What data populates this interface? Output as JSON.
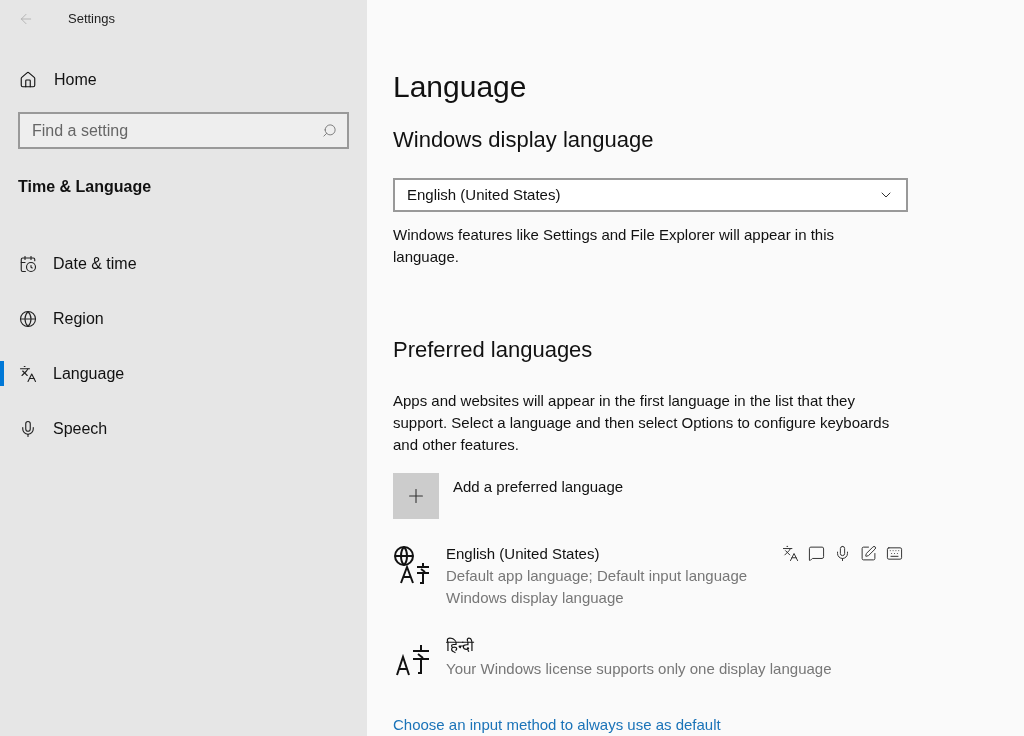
{
  "window": {
    "title": "Settings"
  },
  "sidebar": {
    "home": "Home",
    "search": {
      "placeholder": "Find a setting"
    },
    "section": "Time & Language",
    "items": [
      {
        "label": "Date & time",
        "kind": "datetime",
        "selected": false
      },
      {
        "label": "Region",
        "kind": "region",
        "selected": false
      },
      {
        "label": "Language",
        "kind": "language",
        "selected": true
      },
      {
        "label": "Speech",
        "kind": "speech",
        "selected": false
      }
    ]
  },
  "page": {
    "title": "Language",
    "display_heading": "Windows display language",
    "display_value": "English (United States)",
    "display_note": "Windows features like Settings and File Explorer will appear in this language.",
    "preferred_heading": "Preferred languages",
    "preferred_note": "Apps and websites will appear in the first language in the list that they support. Select a language and then select Options to configure keyboards and other features.",
    "add_label": "Add a preferred language",
    "languages": [
      {
        "name": "English (United States)",
        "kind": "display",
        "details": [
          "Default app language; Default input language",
          "Windows display language"
        ]
      },
      {
        "name": "हिन्दी",
        "kind": "installed",
        "details": [
          "Your Windows license supports only one display language"
        ]
      }
    ],
    "link": "Choose an input method to always use as default"
  }
}
